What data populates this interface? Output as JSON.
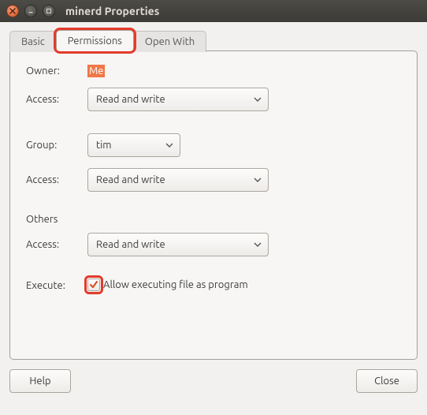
{
  "window": {
    "title": "minerd Properties"
  },
  "tabs": {
    "basic": "Basic",
    "permissions": "Permissions",
    "openwith": "Open With"
  },
  "labels": {
    "owner": "Owner:",
    "access": "Access:",
    "group": "Group:",
    "others": "Others",
    "execute": "Execute:"
  },
  "values": {
    "owner": "Me",
    "owner_access": "Read and write",
    "group": "tim",
    "group_access": "Read and write",
    "others_access": "Read and write",
    "execute_label": "Allow executing file as program",
    "execute_checked": true
  },
  "buttons": {
    "help": "Help",
    "close": "Close"
  },
  "colors": {
    "highlight": "#e33b2b",
    "accent_bg": "#f07746"
  }
}
